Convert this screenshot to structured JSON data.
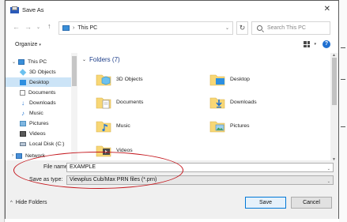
{
  "dialog": {
    "title": "Save As",
    "close_glyph": "✕"
  },
  "address": {
    "back_glyph": "←",
    "forward_glyph": "→",
    "recent_glyph": "⌄",
    "up_glyph": "↑",
    "separator": "›",
    "location": "This PC",
    "dropdown_glyph": "⌄",
    "refresh_glyph": "↻",
    "search_placeholder": "Search This PC"
  },
  "toolbar": {
    "organize_label": "Organize",
    "organize_chevron": "▾",
    "view_chevron": "▾",
    "help_label": "?"
  },
  "nav_pane": {
    "items": [
      {
        "label": "This PC",
        "icon": "computer-icon"
      },
      {
        "label": "3D Objects",
        "icon": "3d-objects-icon"
      },
      {
        "label": "Desktop",
        "icon": "desktop-icon"
      },
      {
        "label": "Documents",
        "icon": "documents-icon"
      },
      {
        "label": "Downloads",
        "icon": "downloads-icon"
      },
      {
        "label": "Music",
        "icon": "music-icon"
      },
      {
        "label": "Pictures",
        "icon": "pictures-icon"
      },
      {
        "label": "Videos",
        "icon": "videos-icon"
      },
      {
        "label": "Local Disk (C:)",
        "icon": "drive-icon"
      },
      {
        "label": "Network",
        "icon": "network-icon"
      }
    ],
    "selected_index": 2
  },
  "main_pane": {
    "section_title": "Folders (7)",
    "section_chevron": "⌄",
    "folders": [
      {
        "label": "3D Objects",
        "icon": "3d-objects-folder-icon"
      },
      {
        "label": "Desktop",
        "icon": "desktop-folder-icon"
      },
      {
        "label": "Documents",
        "icon": "documents-folder-icon"
      },
      {
        "label": "Downloads",
        "icon": "downloads-folder-icon"
      },
      {
        "label": "Music",
        "icon": "music-folder-icon"
      },
      {
        "label": "Pictures",
        "icon": "pictures-folder-icon"
      },
      {
        "label": "Videos",
        "icon": "videos-folder-icon"
      }
    ]
  },
  "save_form": {
    "file_name_label": "File name:",
    "file_name_value": "EXAMPLE",
    "save_as_type_label": "Save as type:",
    "save_as_type_value": "Viewplus Cub/Max PRN files (*.prn)",
    "dropdown_glyph": "⌄"
  },
  "footer": {
    "hide_folders_chevron": "^",
    "hide_folders_label": "Hide Folders",
    "save_label": "Save",
    "cancel_label": "Cancel"
  },
  "colors": {
    "accent": "#0078d7",
    "selection": "#cce4f7",
    "highlight_oval": "#c4161c",
    "folder_yellow": "#f8d775"
  }
}
